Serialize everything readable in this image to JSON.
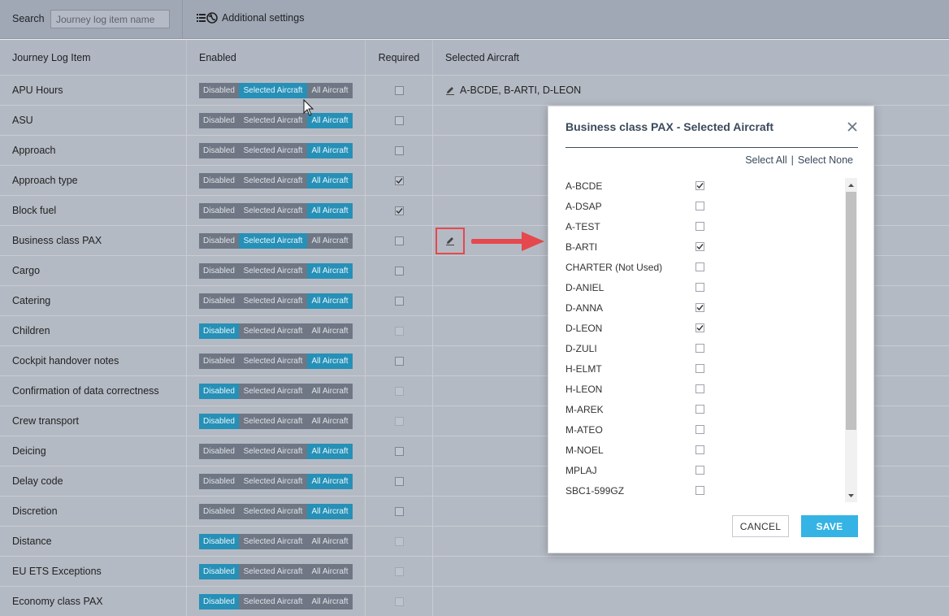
{
  "toolbar": {
    "search_label": "Search",
    "search_placeholder": "Journey log item name",
    "search_value": "",
    "settings_label": "Additional settings",
    "settings_icon": "list-globe-icon"
  },
  "table": {
    "headers": [
      "Journey Log Item",
      "Enabled",
      "Required",
      "Selected Aircraft"
    ],
    "toggle_labels": {
      "disabled": "Disabled",
      "selected": "Selected Aircraft",
      "all": "All Aircraft"
    },
    "rows": [
      {
        "name": "APU Hours",
        "enabled": "selected",
        "required": false,
        "required_disabled": false,
        "aircraft": "A-BCDE, B-ARTI, D-LEON",
        "edit": "plain"
      },
      {
        "name": "ASU",
        "enabled": "all",
        "required": false,
        "required_disabled": false,
        "aircraft": "",
        "edit": "none"
      },
      {
        "name": "Approach",
        "enabled": "all",
        "required": false,
        "required_disabled": false,
        "aircraft": "",
        "edit": "none"
      },
      {
        "name": "Approach type",
        "enabled": "all",
        "required": true,
        "required_disabled": false,
        "aircraft": "",
        "edit": "none"
      },
      {
        "name": "Block fuel",
        "enabled": "all",
        "required": true,
        "required_disabled": false,
        "aircraft": "",
        "edit": "none"
      },
      {
        "name": "Business class PAX",
        "enabled": "selected",
        "required": false,
        "required_disabled": false,
        "aircraft": "",
        "edit": "highlight"
      },
      {
        "name": "Cargo",
        "enabled": "all",
        "required": false,
        "required_disabled": false,
        "aircraft": "",
        "edit": "none"
      },
      {
        "name": "Catering",
        "enabled": "all",
        "required": false,
        "required_disabled": false,
        "aircraft": "",
        "edit": "none"
      },
      {
        "name": "Children",
        "enabled": "disabled",
        "required": false,
        "required_disabled": true,
        "aircraft": "",
        "edit": "none"
      },
      {
        "name": "Cockpit handover notes",
        "enabled": "all",
        "required": false,
        "required_disabled": false,
        "aircraft": "",
        "edit": "none"
      },
      {
        "name": "Confirmation of data correctness",
        "enabled": "disabled",
        "required": false,
        "required_disabled": true,
        "aircraft": "",
        "edit": "none"
      },
      {
        "name": "Crew transport",
        "enabled": "disabled",
        "required": false,
        "required_disabled": true,
        "aircraft": "",
        "edit": "none"
      },
      {
        "name": "Deicing",
        "enabled": "all",
        "required": false,
        "required_disabled": false,
        "aircraft": "",
        "edit": "none"
      },
      {
        "name": "Delay code",
        "enabled": "all",
        "required": false,
        "required_disabled": false,
        "aircraft": "",
        "edit": "none"
      },
      {
        "name": "Discretion",
        "enabled": "all",
        "required": false,
        "required_disabled": false,
        "aircraft": "",
        "edit": "none"
      },
      {
        "name": "Distance",
        "enabled": "disabled",
        "required": false,
        "required_disabled": true,
        "aircraft": "",
        "edit": "none"
      },
      {
        "name": "EU ETS Exceptions",
        "enabled": "disabled",
        "required": false,
        "required_disabled": true,
        "aircraft": "",
        "edit": "none"
      },
      {
        "name": "Economy class PAX",
        "enabled": "disabled",
        "required": false,
        "required_disabled": true,
        "aircraft": "",
        "edit": "none"
      }
    ]
  },
  "modal": {
    "title": "Business class PAX - Selected Aircraft",
    "select_all": "Select All",
    "separator": "|",
    "select_none": "Select None",
    "aircraft": [
      {
        "name": "A-BCDE",
        "checked": true
      },
      {
        "name": "A-DSAP",
        "checked": false
      },
      {
        "name": "A-TEST",
        "checked": false
      },
      {
        "name": "B-ARTI",
        "checked": true
      },
      {
        "name": "CHARTER (Not Used)",
        "checked": false
      },
      {
        "name": "D-ANIEL",
        "checked": false
      },
      {
        "name": "D-ANNA",
        "checked": true
      },
      {
        "name": "D-LEON",
        "checked": true
      },
      {
        "name": "D-ZULI",
        "checked": false
      },
      {
        "name": "H-ELMT",
        "checked": false
      },
      {
        "name": "H-LEON",
        "checked": false
      },
      {
        "name": "M-AREK",
        "checked": false
      },
      {
        "name": "M-ATEO",
        "checked": false
      },
      {
        "name": "M-NOEL",
        "checked": false
      },
      {
        "name": "MPLAJ",
        "checked": false
      },
      {
        "name": "SBC1-599GZ",
        "checked": false
      }
    ],
    "cancel_label": "CANCEL",
    "save_label": "SAVE"
  },
  "colors": {
    "toggle_active": "#2690b7",
    "toggle_inactive": "#6f7784",
    "save_button": "#34b3e4",
    "highlight": "#e5484d",
    "modal_title": "#3b4a5c"
  }
}
